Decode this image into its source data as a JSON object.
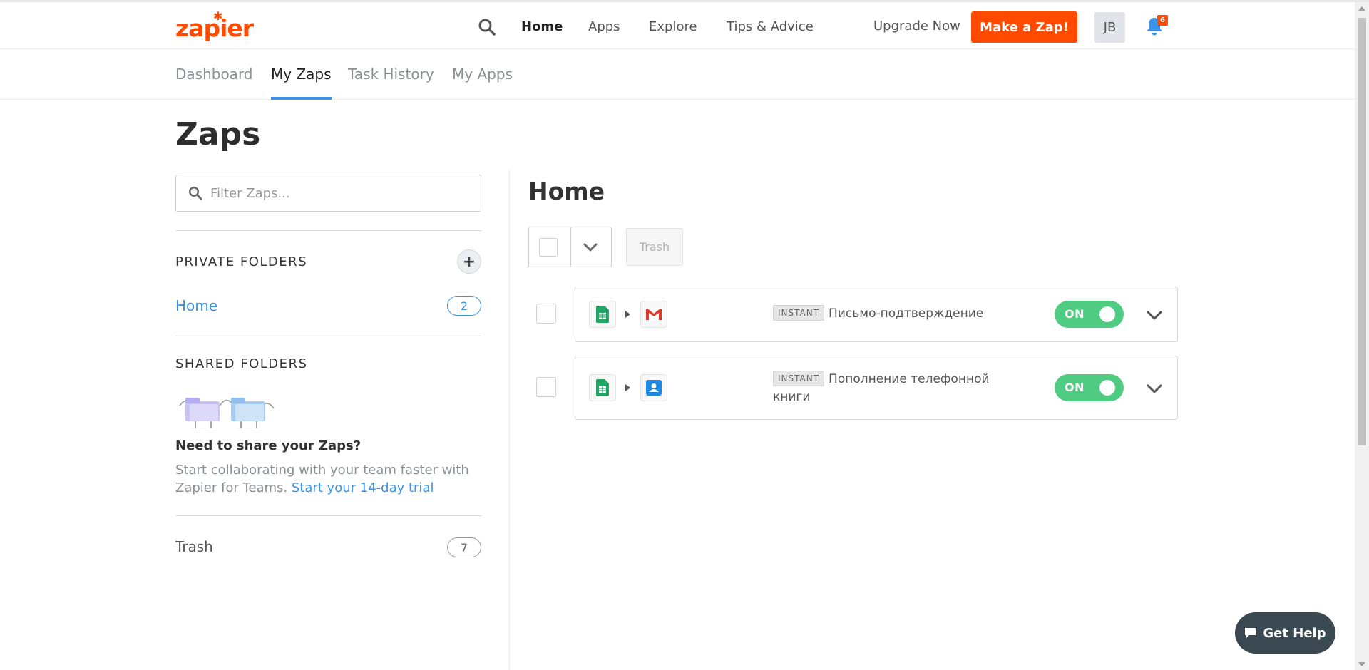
{
  "brand": {
    "logo_text": "zapier",
    "accent_color": "#ff4a00"
  },
  "topnav": {
    "links": [
      {
        "label": "Home",
        "active": true
      },
      {
        "label": "Apps"
      },
      {
        "label": "Explore"
      },
      {
        "label": "Tips & Advice"
      }
    ],
    "upgrade": "Upgrade Now",
    "make_zap": "Make a Zap!",
    "avatar_initials": "JB",
    "notifications_count": "6"
  },
  "subnav": {
    "tabs": [
      {
        "label": "Dashboard"
      },
      {
        "label": "My Zaps",
        "active": true
      },
      {
        "label": "Task History"
      },
      {
        "label": "My Apps"
      }
    ]
  },
  "page": {
    "title": "Zaps"
  },
  "sidebar": {
    "filter_placeholder": "Filter Zaps...",
    "private_heading": "PRIVATE FOLDERS",
    "private_folders": [
      {
        "name": "Home",
        "count": "2"
      }
    ],
    "shared_heading": "SHARED FOLDERS",
    "share_title": "Need to share your Zaps?",
    "share_text": "Start collaborating with your team faster with Zapier for Teams. ",
    "share_link": "Start your 14-day trial",
    "trash": {
      "name": "Trash",
      "count": "7"
    }
  },
  "main": {
    "folder_title": "Home",
    "trash_button": "Trash",
    "zaps": [
      {
        "tag": "INSTANT",
        "title": "Письмо-подтверждение",
        "trigger_icon": "google-sheets-icon",
        "action_icon": "gmail-icon",
        "status": "ON"
      },
      {
        "tag": "INSTANT",
        "title": "Пополнение телефонной книги",
        "trigger_icon": "google-sheets-icon",
        "action_icon": "google-contacts-icon",
        "status": "ON"
      }
    ]
  },
  "help": {
    "label": "Get Help"
  }
}
